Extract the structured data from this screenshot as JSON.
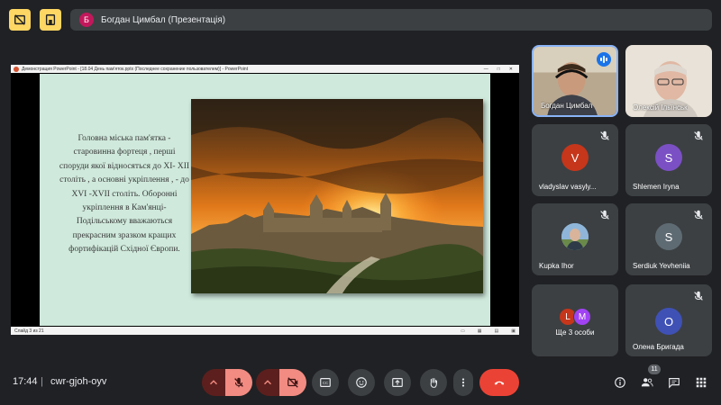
{
  "header": {
    "presenter_initial": "Б",
    "presenter_title": "Богдан Цимбал (Презентація)"
  },
  "presentation": {
    "window_title": "Демонстрация PowerPoint - [18.04 День пам'яток.pptx (Последнее сохранение пользователем)] - PowerPoint",
    "slide_text": "Головна міська пам'ятка - старовинна фортеця , перші споруди якої відносяться до XI- XII століть , а основні укріплення , - до XVI -XVII століть. Оборонні укріплення в Кам'янці-Подільському вважаються прекрасним зразком кращих фортифікацій Східної Європи.",
    "status_text": "Слайд 3 из 21"
  },
  "participants": [
    {
      "name": "Богдан Цимбал",
      "type": "video",
      "speaking": true
    },
    {
      "name": "Олексій Ільїнськ",
      "type": "video",
      "speaking": false
    },
    {
      "name": "vladyslav vasyly...",
      "initial": "V",
      "color": "#c5361b",
      "muted": true
    },
    {
      "name": "Shlemen Iryna",
      "initial": "S",
      "color": "#7b50c4",
      "muted": true
    },
    {
      "name": "Kupka Ihor",
      "type": "photo",
      "muted": true
    },
    {
      "name": "Serdiuk Yevheniia",
      "initial": "S",
      "color": "#5f6b73",
      "muted": true
    },
    {
      "name": "Ще 3 особи",
      "group_initials": [
        "L",
        "M"
      ],
      "group_colors": [
        "#c5361b",
        "#a142f4"
      ]
    },
    {
      "name": "Олена Бригада",
      "initial": "O",
      "color": "#3f51b5",
      "muted": true
    }
  ],
  "bottom_bar": {
    "time": "17:44",
    "separator": "|",
    "meeting_code": "cwr-gjoh-oyv",
    "participant_count": "11"
  },
  "colors": {
    "background": "#202124",
    "accent_yellow": "#fdd663",
    "end_call": "#ea4335",
    "muted_red": "#f28b82"
  }
}
